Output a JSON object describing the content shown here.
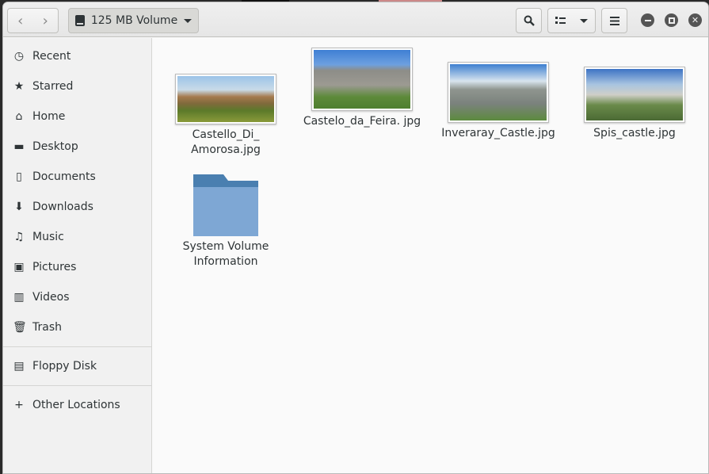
{
  "header": {
    "path_label": "125 MB Volume",
    "back_icon": "chevron-left-icon",
    "forward_icon": "chevron-right-icon"
  },
  "sidebar": {
    "items": [
      {
        "label": "Recent",
        "icon": "recent-icon"
      },
      {
        "label": "Starred",
        "icon": "star-icon"
      },
      {
        "label": "Home",
        "icon": "home-icon"
      },
      {
        "label": "Desktop",
        "icon": "folder-icon"
      },
      {
        "label": "Documents",
        "icon": "documents-icon"
      },
      {
        "label": "Downloads",
        "icon": "downloads-icon"
      },
      {
        "label": "Music",
        "icon": "music-icon"
      },
      {
        "label": "Pictures",
        "icon": "pictures-icon"
      },
      {
        "label": "Videos",
        "icon": "videos-icon"
      },
      {
        "label": "Trash",
        "icon": "trash-icon"
      }
    ],
    "devices": [
      {
        "label": "Floppy Disk",
        "icon": "floppy-icon"
      }
    ],
    "other": {
      "label": "Other Locations",
      "icon": "plus-icon"
    }
  },
  "files": [
    {
      "name": "Castello_Di_ Amorosa.jpg"
    },
    {
      "name": "Castelo_da_Feira. jpg"
    },
    {
      "name": "Inveraray_Castle.jpg"
    },
    {
      "name": "Spis_castle.jpg"
    },
    {
      "name": "System Volume Information"
    }
  ]
}
